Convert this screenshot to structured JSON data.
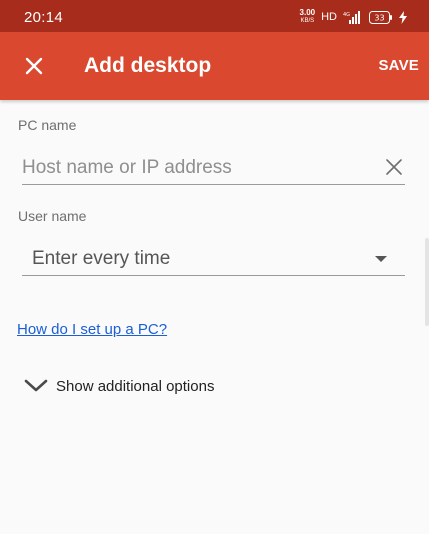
{
  "status_bar": {
    "time": "20:14",
    "net_speed_value": "3.00",
    "net_speed_unit": "KB/S",
    "hd_label": "HD",
    "battery_level": "33",
    "icons": [
      "signal-icon",
      "battery-icon",
      "charging-icon"
    ]
  },
  "app_bar": {
    "title": "Add desktop",
    "save_label": "SAVE",
    "close_icon": "close-icon",
    "background_color": "#d9482f"
  },
  "form": {
    "pc_name_label": "PC name",
    "pc_name_placeholder": "Host name or IP address",
    "pc_name_value": "",
    "user_name_label": "User name",
    "user_name_value": "Enter every time"
  },
  "help_link": "How do I set up a PC?",
  "additional_options": "Show additional options"
}
